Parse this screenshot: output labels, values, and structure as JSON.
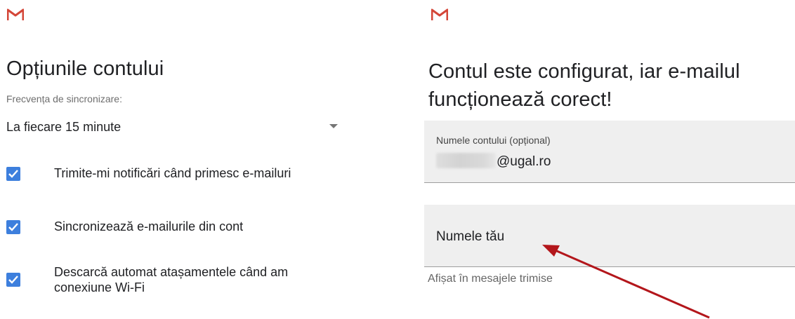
{
  "left_screen": {
    "logo": "gmail-logo-icon",
    "title": "Opțiunile contului",
    "sync_frequency": {
      "label": "Frecvența de sincronizare:",
      "selected_value": "La fiecare 15 minute"
    },
    "options": [
      {
        "label": "Trimite-mi notificări când primesc e-mailuri",
        "checked": true
      },
      {
        "label": "Sincronizează e-mailurile din cont",
        "checked": true
      },
      {
        "label": "Descarcă automat atașamentele când am conexiune Wi-Fi",
        "checked": true
      }
    ]
  },
  "right_screen": {
    "logo": "gmail-logo-icon",
    "title": "Contul este configurat, iar e-mailul funcționează corect!",
    "account_name_field": {
      "label": "Numele contului (opțional)",
      "value_suffix": "@ugal.ro"
    },
    "your_name_field": {
      "placeholder": "Numele tău",
      "helper_text": "Afișat în mesajele trimise"
    }
  },
  "colors": {
    "gmail_red": "#d44638",
    "checkbox_blue": "#3d7fdd",
    "annotation_arrow": "#b3161b"
  }
}
